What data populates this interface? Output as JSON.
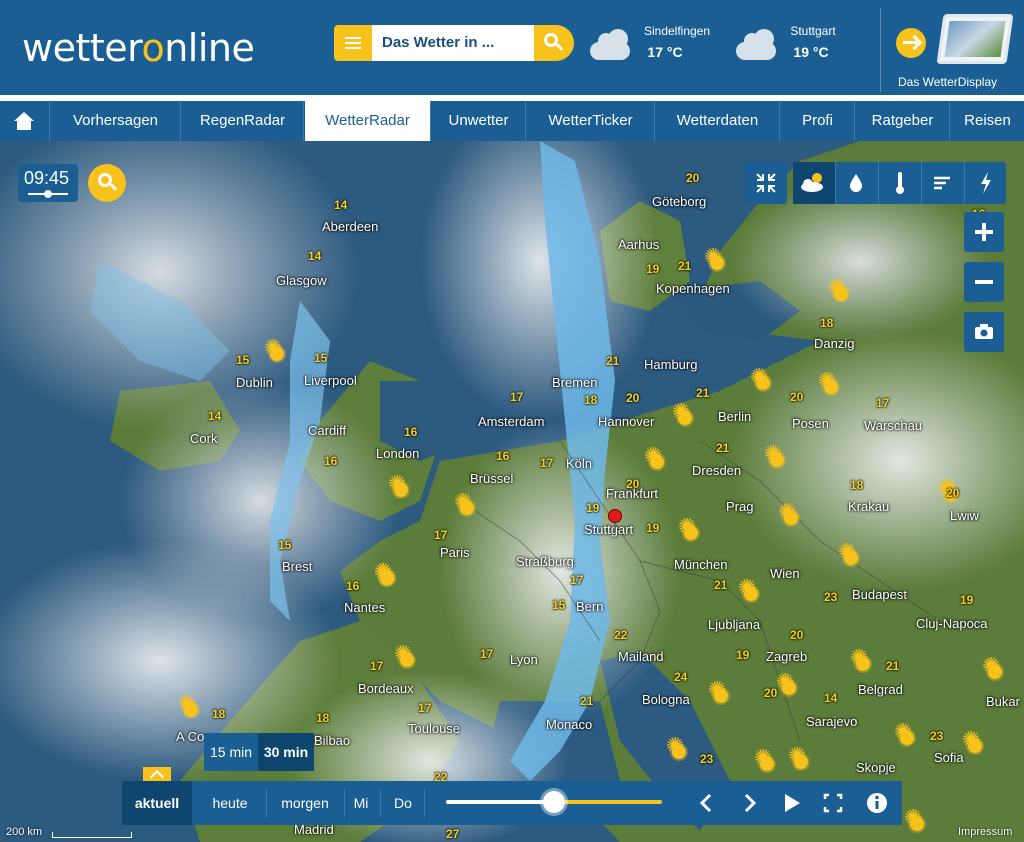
{
  "header": {
    "logo_prefix": "wetter",
    "logo_o": "o",
    "logo_suffix": "nline",
    "search": {
      "placeholder": "Das Wetter in ..."
    },
    "locations": [
      {
        "name": "Sindelfingen",
        "temp": "17 °C",
        "icon": "cloud-icon"
      },
      {
        "name": "Stuttgart",
        "temp": "19 °C",
        "icon": "cloud-icon"
      }
    ],
    "display_label": "Das WetterDisplay"
  },
  "nav": {
    "home_icon": "home-icon",
    "items": [
      {
        "label": "Vorhersagen"
      },
      {
        "label": "RegenRadar"
      },
      {
        "label": "WetterRadar",
        "active": true
      },
      {
        "label": "Unwetter"
      },
      {
        "label": "WetterTicker"
      },
      {
        "label": "Wetterdaten"
      },
      {
        "label": "Profi"
      },
      {
        "label": "Ratgeber"
      },
      {
        "label": "Reisen"
      }
    ]
  },
  "map": {
    "time": "09:45",
    "interval": {
      "options": [
        "15 min",
        "30 min"
      ],
      "selected": "30 min"
    },
    "days": [
      "aktuell",
      "heute",
      "morgen",
      "Mi",
      "Do"
    ],
    "active_day": "aktuell",
    "timeline_progress": 0.5,
    "scale_label": "200 km",
    "impressum": "Impressum",
    "layers": [
      "collapse-icon",
      "sun-cloud-icon",
      "rain-drop-icon",
      "thermometer-icon",
      "wind-icon",
      "lightning-icon"
    ],
    "cities": [
      "Aberdeen",
      "Glasgow",
      "Dublin",
      "Liverpool",
      "Cork",
      "Cardiff",
      "London",
      "Brest",
      "Nantes",
      "Bordeaux",
      "Toulouse",
      "Bilbao",
      "Madrid",
      "Paris",
      "Brüssel",
      "Amsterdam",
      "Bremen",
      "Hamburg",
      "Hannover",
      "Köln",
      "Frankfurt",
      "Stuttgart",
      "Straßburg",
      "Bern",
      "Lyon",
      "Mailand",
      "Monaco",
      "Bologna",
      "München",
      "Wien",
      "Prag",
      "Dresden",
      "Berlin",
      "Kopenhagen",
      "Aarhus",
      "Göteborg",
      "Danzig",
      "Posen",
      "Warschau",
      "Krakau",
      "Lwiw",
      "Budapest",
      "Ljubljana",
      "Zagreb",
      "Cluj-Napoca",
      "Belgrad",
      "Sarajevo",
      "Skopje",
      "Sofia",
      "Bukar",
      "A Co"
    ],
    "temps": [
      "14",
      "14",
      "15",
      "15",
      "14",
      "16",
      "16",
      "15",
      "16",
      "17",
      "17",
      "18",
      "18",
      "17",
      "16",
      "17",
      "18",
      "21",
      "20",
      "17",
      "19",
      "19",
      "17",
      "15",
      "17",
      "22",
      "24",
      "21",
      "20",
      "20",
      "21",
      "21",
      "21",
      "20",
      "17",
      "18",
      "20",
      "19",
      "20",
      "23",
      "19",
      "21",
      "14",
      "23",
      "23",
      "20",
      "18",
      "16",
      "19",
      "21",
      "22",
      "27"
    ]
  }
}
